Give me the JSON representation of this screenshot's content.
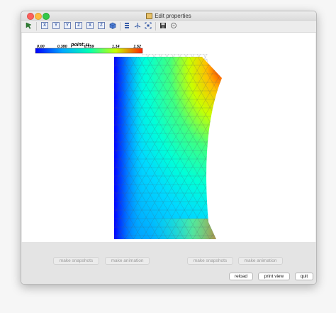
{
  "window": {
    "title": "Edit properties"
  },
  "toolbar": {
    "axis_buttons": [
      "X",
      "Y",
      "Y",
      "Z",
      "X",
      "Z"
    ],
    "icons": [
      "select-arrow-icon",
      "view-x-icon",
      "view-y-icon",
      "view-z-icon",
      "cube-icon",
      "bars-icon",
      "axes-icon",
      "fit-icon",
      "save-icon",
      "reset-icon"
    ]
  },
  "colorbar": {
    "title": "point: u",
    "ticks": [
      "0.00",
      "0.380",
      "0.759",
      "1.14",
      "1.52"
    ],
    "min": 0.0,
    "max": 1.52,
    "colormap": [
      "#0000ff",
      "#00c8ff",
      "#00ffc0",
      "#c8ff00",
      "#ff6000",
      "#ff0000"
    ]
  },
  "bottom": {
    "left_snapshot": "make snapshots",
    "left_animation": "make animation",
    "right_snapshot": "make snapshots",
    "right_animation": "make animation",
    "reload": "reload",
    "print_view": "print view",
    "quit": "quit"
  }
}
